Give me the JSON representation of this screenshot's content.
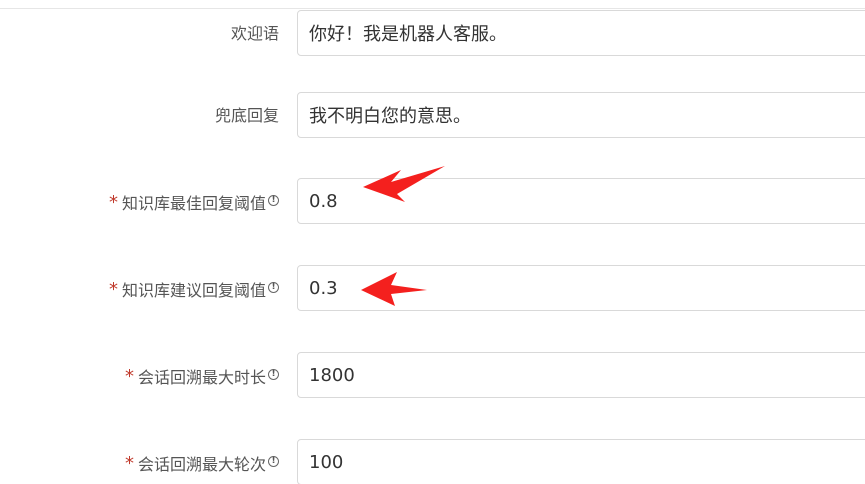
{
  "form": {
    "rows": [
      {
        "label": "欢迎语",
        "required": false,
        "info": false,
        "value": "你好！我是机器人客服。"
      },
      {
        "label": "兜底回复",
        "required": false,
        "info": false,
        "value": "我不明白您的意思。"
      },
      {
        "label": "知识库最佳回复阈值",
        "required": true,
        "info": true,
        "value": "0.8"
      },
      {
        "label": "知识库建议回复阈值",
        "required": true,
        "info": true,
        "value": "0.3"
      },
      {
        "label": "会话回溯最大时长",
        "required": true,
        "info": true,
        "value": "1800"
      },
      {
        "label": "会话回溯最大轮次",
        "required": true,
        "info": true,
        "value": "100"
      }
    ],
    "required_mark": "*",
    "info_glyph": "!"
  },
  "colors": {
    "arrow": "#f4201e",
    "required": "#c0392b",
    "border": "#d9d9d9"
  }
}
